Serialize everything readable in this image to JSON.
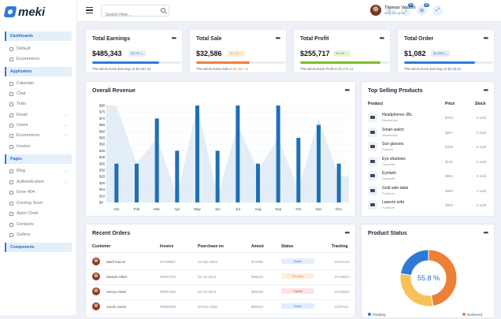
{
  "brand": {
    "name": "meki"
  },
  "sidebar": {
    "sections": [
      {
        "label": "Dashboards",
        "items": [
          {
            "label": "Default"
          },
          {
            "label": "Ecommerce"
          }
        ]
      },
      {
        "label": "Application",
        "items": [
          {
            "label": "Calendar"
          },
          {
            "label": "Chat"
          },
          {
            "label": "Todo"
          },
          {
            "label": "Email"
          },
          {
            "label": "Users"
          },
          {
            "label": "Ecommerce"
          },
          {
            "label": "Invoice"
          }
        ]
      },
      {
        "label": "Pages",
        "items": [
          {
            "label": "Blog"
          },
          {
            "label": "Authentication"
          },
          {
            "label": "Error 404"
          },
          {
            "label": "Coming Soon"
          },
          {
            "label": "Apex Chart"
          },
          {
            "label": "Contacts"
          },
          {
            "label": "Gallery"
          }
        ]
      },
      {
        "label": "Components",
        "items": []
      }
    ]
  },
  "topbar": {
    "search_placeholder": "Search Here ...",
    "notif_count": "10",
    "cart_count": "05",
    "user_name": "Thomas Vactom",
    "user_role": "web designer"
  },
  "stats": [
    {
      "title": "Total Earnings",
      "value": "$485,343",
      "pct": "35.7%",
      "note_prefix": "This Week Extra Earnings in",
      "note_value": "$1,927.24",
      "color": "#2d7ad6",
      "progress": 0.75
    },
    {
      "title": "Total Sale",
      "value": "$32,586",
      "pct": "20.7%",
      "note_prefix": "This Week Extra Sale in",
      "note_value": "$1,627.24",
      "color": "#ee7f36",
      "progress": 0.6
    },
    {
      "title": "Total Profit",
      "value": "$255,717",
      "pct": "30.4%",
      "note_prefix": "This Week Extra Profit in",
      "note_value": "$1,074.24",
      "color": "#7cbb2f",
      "progress": 0.9
    },
    {
      "title": "Total Order",
      "value": "$1,082",
      "pct": "30.50%",
      "note_prefix": "This Week Extra Earnings in",
      "note_value": "$1,20.24",
      "color": "#2d7ad6",
      "progress": 0.8
    }
  ],
  "revenue": {
    "title": "Overall Revenue"
  },
  "chart_data": {
    "type": "bar",
    "title": "Overall Revenue",
    "categories": [
      "Jan",
      "Feb",
      "Mar",
      "Apr",
      "May",
      "Jun",
      "Jul",
      "Aug",
      "Sep",
      "Oct",
      "Nov",
      "Dec"
    ],
    "y_tick_labels": [
      "$0",
      "$10",
      "$15",
      "$20",
      "$25",
      "$30",
      "$35",
      "$40",
      "$45",
      "$50",
      "$55",
      "$60",
      "$65",
      "$70",
      "$75",
      "$80"
    ],
    "tick_index": [
      0,
      1,
      2,
      3,
      4,
      5,
      6,
      7,
      8,
      9,
      10,
      11,
      12,
      13,
      14,
      15
    ],
    "values_tick_index": [
      6,
      6,
      13,
      8,
      15,
      8,
      15,
      6,
      15,
      10,
      12,
      6
    ],
    "series": [
      {
        "values": [
          35,
          35,
          70,
          45,
          80,
          45,
          80,
          35,
          80,
          55,
          65,
          35
        ],
        "color": "#1f6fb6"
      }
    ],
    "area_values": [
      15,
      6,
      10,
      1,
      15,
      1,
      12,
      5,
      10,
      2,
      13,
      4
    ],
    "area_color": "#e3edf8",
    "grid": true
  },
  "top_selling": {
    "title": "Top Selling Products",
    "headers": [
      "Product",
      "Price",
      "Stock"
    ],
    "rows": [
      {
        "name": "Headphones JBL",
        "cat": "Electronics",
        "price": "$753",
        "stock": "5 sold"
      },
      {
        "name": "Smart watch",
        "cat": "Electronics",
        "price": "$837",
        "stock": "2 sold"
      },
      {
        "name": "Sun glasses",
        "cat": "Fashion",
        "price": "$459",
        "stock": "6 sold"
      },
      {
        "name": "Eye shadows",
        "cat": "Cosmatic",
        "price": "$146",
        "stock": "5 sold"
      },
      {
        "name": "Eyelash",
        "cat": "Cosmatic",
        "price": "$992",
        "stock": "5 sold"
      },
      {
        "name": "Gold side table",
        "cat": "Furniture",
        "price": "$990",
        "stock": "2 sold"
      },
      {
        "name": "Lawson sofa",
        "cat": "Furniture",
        "price": "$902",
        "stock": "5 sold"
      }
    ]
  },
  "recent_orders": {
    "title": "Recent Orders",
    "headers": [
      "Customer",
      "Invoice",
      "Pusrchase on",
      "Amout",
      "Status",
      "Tracking"
    ],
    "rows": [
      {
        "name": "Mark Dacon",
        "invoice": "#4769587",
        "date": "15 Mar 2022",
        "amount": "$72596",
        "status": "Done",
        "tracking": "DO4YOU",
        "status_bg": "#e2eefb",
        "status_fg": "#2d6bc4"
      },
      {
        "name": "Wanda Odiel",
        "invoice": "#0987345",
        "date": "03 Jul 2022",
        "amount": "$96548",
        "status": "Pending",
        "tracking": "PU4MKU",
        "status_bg": "#fdeede",
        "status_fg": "#ee7f36"
      },
      {
        "name": "Sveryo Mark",
        "invoice": "#0987345",
        "date": "03 Jul 2022",
        "amount": "$96548",
        "status": "Cancle",
        "tracking": "PU4MKU",
        "status_bg": "#fde3e3",
        "status_fg": "#e04545"
      },
      {
        "name": "Jacob Jones",
        "invoice": "#9896300",
        "date": "20 Nov 2022",
        "amount": "$95620",
        "status": "Done",
        "tracking": "IOSPHU",
        "status_bg": "#e2eefb",
        "status_fg": "#2d6bc4"
      }
    ]
  },
  "product_status": {
    "title": "Product Status",
    "center_label": "55.8 %",
    "segments": [
      {
        "label": "Panding",
        "value": 55.8,
        "color": "#2d7ad6"
      },
      {
        "label": "Delivered",
        "value": 44.2,
        "color": "#ee7f36"
      }
    ],
    "inner_segments": [
      {
        "value": 30,
        "color": "#f7c257"
      },
      {
        "value": 25,
        "color": "#2d7ad6"
      }
    ]
  }
}
